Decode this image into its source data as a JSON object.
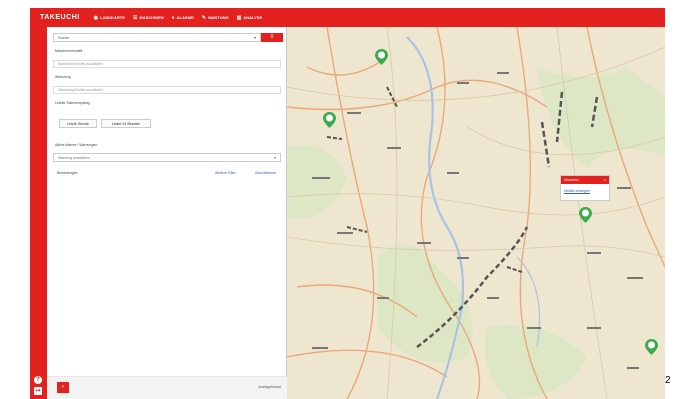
{
  "app": {
    "logo": "TAKEUCHI"
  },
  "nav": [
    {
      "icon": "location-icon",
      "label": "LANDKARTE"
    },
    {
      "icon": "list-icon",
      "label": "MASCHINEN"
    },
    {
      "icon": "alarm-icon",
      "label": "ALARME"
    },
    {
      "icon": "wrench-icon",
      "label": "WARTUNG"
    },
    {
      "icon": "chart-icon",
      "label": "ANALYSE"
    }
  ],
  "search": {
    "placeholder": "Suche",
    "icon": "search-icon"
  },
  "filters": {
    "field1_label": "Maschinenmodell",
    "field1_placeholder": "Maschinenmodell auswählen",
    "field2_label": "Werkzeug",
    "field2_placeholder": "Werkzeug/Geräte auswählen",
    "section_label": "Letzter Datenempfang",
    "btn1": "Letzte Stunde",
    "btn2": "Letzte 24 Stunden",
    "select_label": "Aktive Alarme / Warnungen",
    "select_placeholder": "Warnung auswählen",
    "row_left": "Bewertungen",
    "row_mid": "Weitere Filter",
    "row_right": "Zurücksetzen"
  },
  "footer": {
    "label": "Anzeigeformat"
  },
  "popup": {
    "title": "Maschine",
    "link": "Details anzeigen"
  },
  "scale_text": "2",
  "colors": {
    "brand": "#e3211f",
    "marker": "#3cab4e"
  }
}
